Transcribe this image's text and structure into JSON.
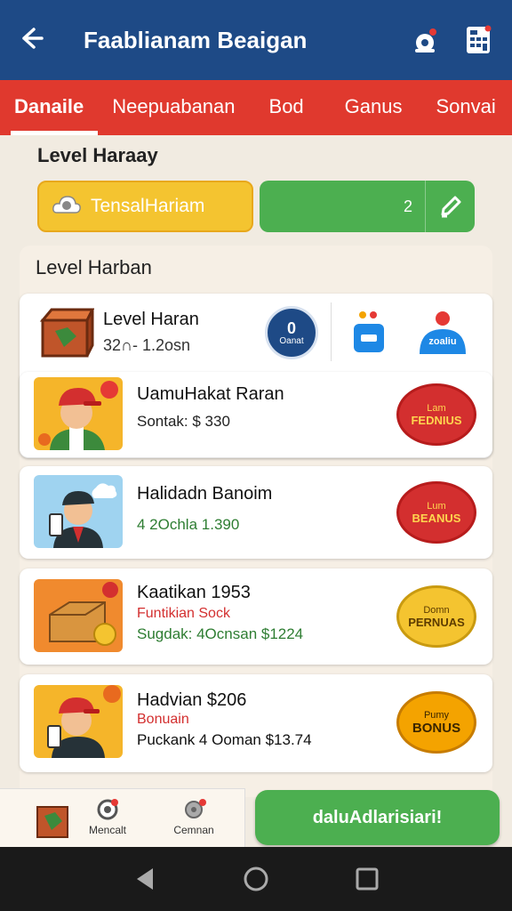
{
  "appbar": {
    "title": "Faablianam Beaigan"
  },
  "tabs": [
    {
      "label": "Danaile",
      "active": true
    },
    {
      "label": "Neepuabanan"
    },
    {
      "label": "Bod"
    },
    {
      "label": "Ganus"
    },
    {
      "label": "Sonvai"
    }
  ],
  "level_header": {
    "title": "Level Haraay"
  },
  "pill": {
    "left_label": "TensalHariam",
    "right_value": "2"
  },
  "panel": {
    "title": "Level Harban"
  },
  "summary": {
    "title": "Level Haran",
    "value": "32∩- 1.2osn",
    "circle_label": "Oanat",
    "chip_label": "zoaliu"
  },
  "rows": [
    {
      "name": "UamuHakat Raran",
      "line1": "Sontak: $ 330",
      "line2": "",
      "badge_top": "Lam",
      "badge": "FEDNIUS",
      "badge_style": "red"
    },
    {
      "name": "Halidadn Banoim",
      "line1": "4 2Ochla 1.390",
      "line2": "",
      "badge_top": "Lum",
      "badge": "BEANUS",
      "badge_style": "red"
    },
    {
      "name": "Kaatikan 1953",
      "line1": "Funtikian Sock",
      "line2": "Sugdak: 4Ocnsan $1224",
      "badge_top": "Domn",
      "badge": "PERNUAS",
      "badge_style": "yellow"
    },
    {
      "name": "Hadvian $206",
      "line1": "Bonuain",
      "line2": "Puckank 4 Ooman $13.74",
      "badge_top": "Pumy",
      "badge": "BONUS",
      "badge_style": "orange"
    }
  ],
  "bottombar": {
    "item1": "Mencalt",
    "item2": "Cemnan",
    "cta": "daluAdlarisiari!"
  },
  "colors": {
    "primary": "#1e4a86",
    "tab_red": "#e0392e",
    "green": "#4caf50",
    "yellow": "#f4c430"
  }
}
